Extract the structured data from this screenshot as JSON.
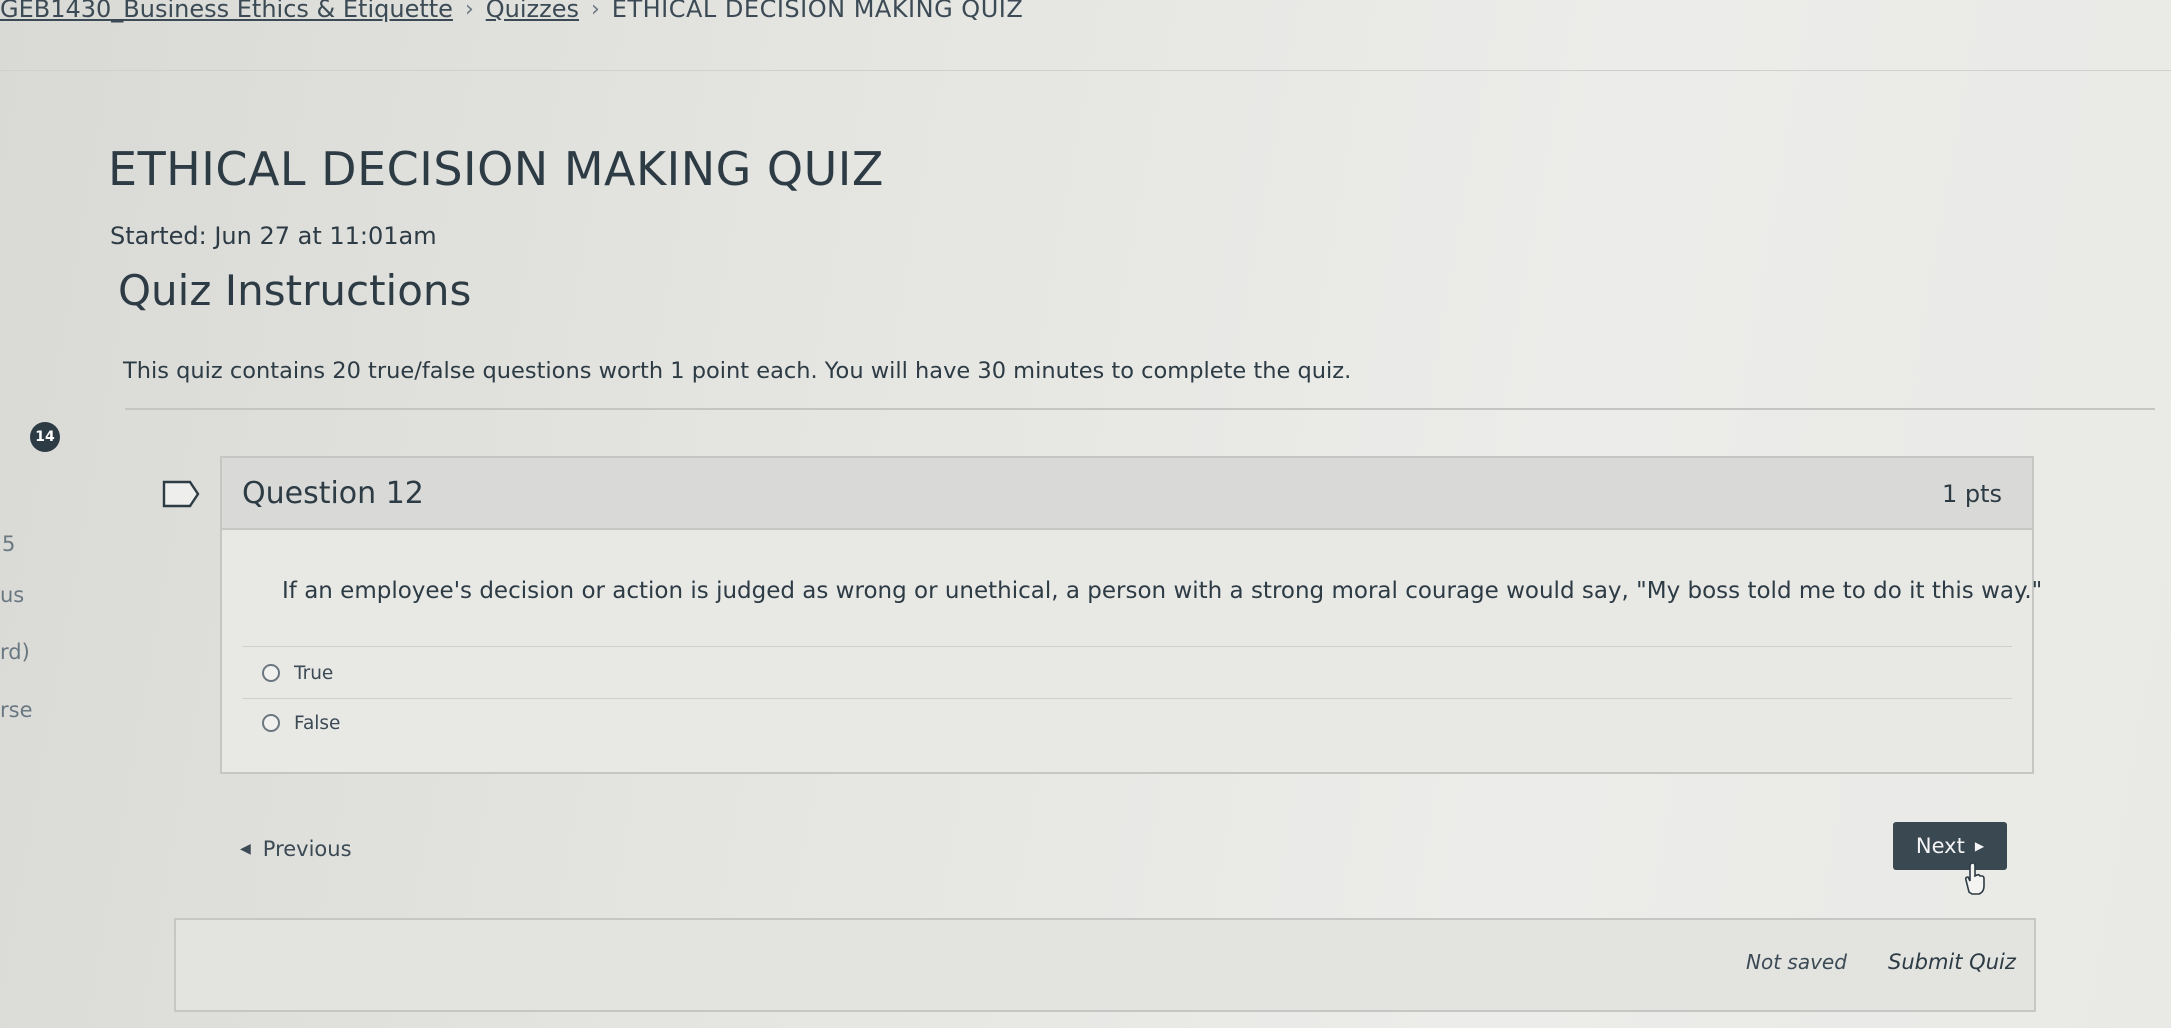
{
  "breadcrumb": {
    "course": "GEB1430_Business Ethics & Etiquette",
    "section": "Quizzes",
    "current": "ETHICAL DECISION MAKING QUIZ",
    "separator": "›"
  },
  "quiz": {
    "title": "ETHICAL DECISION MAKING QUIZ",
    "started": "Started: Jun 27 at 11:01am",
    "instructions_heading": "Quiz Instructions",
    "instructions_text": "This quiz contains 20 true/false questions worth 1 point each. You will have 30 minutes to complete the quiz."
  },
  "left_nav": {
    "badge_count": "14",
    "fragments": [
      "5",
      "us",
      "rd)",
      "rse"
    ]
  },
  "question": {
    "title": "Question 12",
    "points": "1 pts",
    "text": "If an employee's decision or action is judged as wrong or unethical, a person with a strong moral courage would say, \"My boss told me to do it this way.\"",
    "answers": [
      {
        "label": "True",
        "selected": false
      },
      {
        "label": "False",
        "selected": false
      }
    ]
  },
  "navigation": {
    "previous_label": "Previous",
    "next_label": "Next"
  },
  "footer": {
    "status": "Not saved",
    "submit_label": "Submit Quiz"
  },
  "colors": {
    "text": "#2d3b45",
    "next_button": "#3a4852",
    "header_bg": "#d9dad7"
  },
  "icons": {
    "flag": "flag-icon",
    "previous": "triangle-left-icon",
    "next": "triangle-right-icon",
    "cursor": "hand-cursor-icon"
  }
}
